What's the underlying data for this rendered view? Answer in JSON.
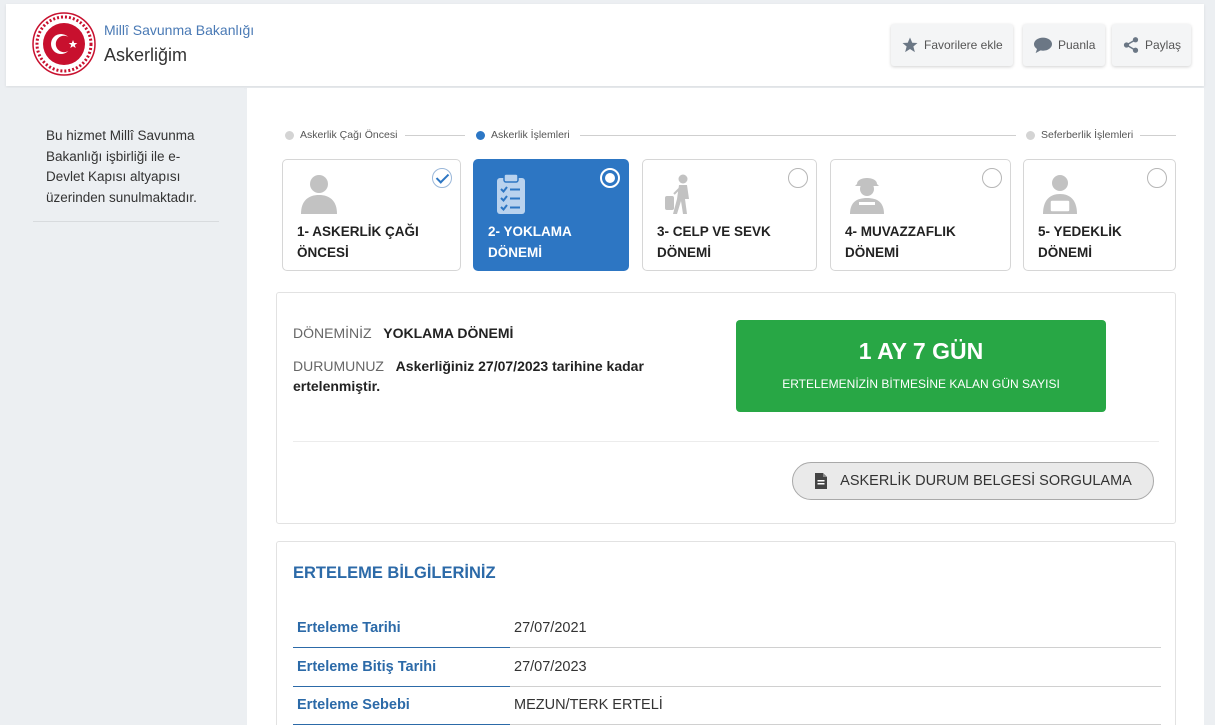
{
  "header": {
    "org_name": "Millî Savunma Bakanlığı",
    "app_name": "Askerliğim",
    "favorite_label": "Favorilere ekle",
    "rate_label": "Puanla",
    "share_label": "Paylaş"
  },
  "sidebar": {
    "info_text": "Bu hizmet Millî Savunma Bakanlığı işbirliği ile e-Devlet Kapısı altyapısı üzerinden sunulmaktadır."
  },
  "stages": [
    {
      "label": "Askerlik Çağı Öncesi",
      "active": false
    },
    {
      "label": "Askerlik İşlemleri",
      "active": true
    },
    {
      "label": "Seferberlik İşlemleri",
      "active": false
    }
  ],
  "periods": [
    {
      "label": "1- ASKERLİK ÇAĞI ÖNCESİ",
      "icon": "person-icon",
      "state": "completed"
    },
    {
      "label": "2- YOKLAMA DÖNEMİ",
      "icon": "clipboard-icon",
      "state": "current"
    },
    {
      "label": "3- CELP VE SEVK DÖNEMİ",
      "icon": "traveler-icon",
      "state": "pending"
    },
    {
      "label": "4- MUVAZZAFLIK DÖNEMİ",
      "icon": "soldier-icon",
      "state": "pending"
    },
    {
      "label": "5- YEDEKLİK DÖNEMİ",
      "icon": "reservist-icon",
      "state": "pending"
    }
  ],
  "status": {
    "period_key": "DÖNEMİNİZ",
    "period_value": "YOKLAMA DÖNEMİ",
    "state_key": "DURUMUNUZ",
    "state_value_1": "Askerliğiniz 27/07/2023 tarihine kadar",
    "state_value_2": "ertelenmiştir.",
    "remaining": "1 AY 7 GÜN",
    "remaining_caption": "ERTELEMENİZİN BİTMESİNE KALAN GÜN SAYISI",
    "document_button": "ASKERLİK DURUM BELGESİ SORGULAMA"
  },
  "deferral": {
    "title": "ERTELEME BİLGİLERİNİZ",
    "rows": [
      {
        "label": "Erteleme Tarihi",
        "value": "27/07/2021"
      },
      {
        "label": "Erteleme Bitiş Tarihi",
        "value": "27/07/2023"
      },
      {
        "label": "Erteleme Sebebi",
        "value": "MEZUN/TERK ERTELİ"
      }
    ]
  },
  "colors": {
    "primary": "#2d76c3",
    "success": "#28a745",
    "brand_red": "#c8102e"
  }
}
